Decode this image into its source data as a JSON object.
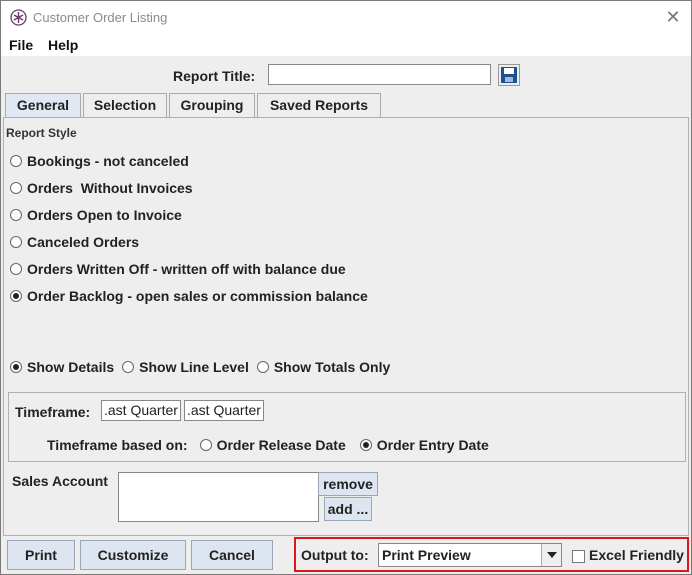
{
  "window": {
    "title": "Customer Order Listing",
    "close_glyph": "✕"
  },
  "menu": [
    "File",
    "Help"
  ],
  "report_title": {
    "label": "Report Title:",
    "value": ""
  },
  "tabs": [
    "General",
    "Selection",
    "Grouping",
    "Saved Reports"
  ],
  "active_tab": "General",
  "report_style": {
    "label": "Report Style",
    "options": [
      "Bookings - not canceled",
      "Orders  Without Invoices",
      "Orders Open to Invoice",
      "Canceled Orders",
      "Orders Written Off - written off with balance due",
      "Order Backlog - open sales or commission balance"
    ],
    "selected": "Order Backlog - open sales or commission balance"
  },
  "detail_level": {
    "options": [
      "Show Details",
      "Show Line Level",
      "Show Totals Only"
    ],
    "selected": "Show Details"
  },
  "timeframe": {
    "label": "Timeframe:",
    "from": ".ast Quarter",
    "to": ".ast Quarter",
    "based_on_label": "Timeframe based on:",
    "based_on_options": [
      "Order Release Date",
      "Order Entry Date"
    ],
    "based_on_selected": "Order Entry Date"
  },
  "sales_account": {
    "label": "Sales Account",
    "remove_label": "remove",
    "add_label": "add ..."
  },
  "buttons": {
    "print": "Print",
    "customize": "Customize",
    "cancel": "Cancel"
  },
  "output": {
    "label": "Output to:",
    "selected": "Print Preview",
    "excel_label": "Excel Friendly",
    "excel_checked": false
  },
  "colors": {
    "highlight_border": "#e0141b",
    "tab_active": "#dfe8f3",
    "button_face": "#dde6f0"
  },
  "icons": [
    "app-logo-icon",
    "close-icon",
    "save-icon",
    "chevron-down-icon"
  ]
}
